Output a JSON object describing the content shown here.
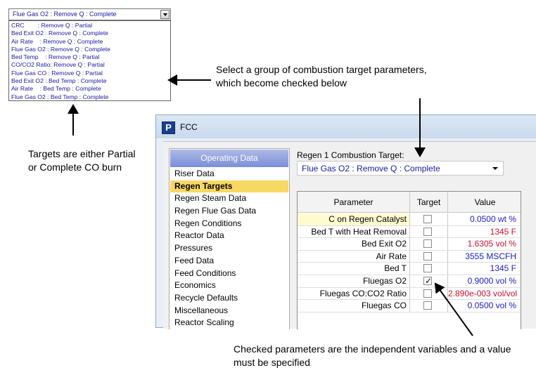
{
  "dropdown": {
    "selected": "Flue Gas O2 : Remove Q : Complete",
    "options": [
      "CRC        : Remove Q : Partial",
      "Bed Exit O2 : Remove Q : Complete",
      "Air Rate    : Remove Q : Complete",
      "Flue Gas O2 : Remove Q : Complete",
      "Bed Temp    : Remove Q : Partial",
      "CO/CO2 Ratio: Remove Q : Partial",
      "Flue Gas CO : Remove Q : Partial",
      "Bed Exit O2 : Bed Temp : Complete",
      "Air Rate    : Bed Temp : Complete",
      "Flue Gas O2 : Bed Temp : Complete"
    ]
  },
  "annotations": {
    "select_group": "Select a group of combustion target parameters, which become checked below",
    "targets_partial": "Targets are either Partial or Complete CO burn",
    "checked_params": "Checked parameters are the independent variables and a value must be specified"
  },
  "window": {
    "title": "FCC",
    "logo": "P"
  },
  "nav": {
    "header": "Operating Data",
    "items": [
      "Riser Data",
      "Regen Targets",
      "Regen Steam Data",
      "Regen Flue Gas Data",
      "Regen Conditions",
      "Reactor Data",
      "Pressures",
      "Feed Data",
      "Feed Conditions",
      "Economics",
      "Recycle Defaults",
      "Miscellaneous",
      "Reactor Scaling"
    ],
    "selected_index": 1
  },
  "combustion_target": {
    "label": "Regen 1 Combustion Target:",
    "value": "Flue Gas O2 : Remove Q : Complete"
  },
  "grid": {
    "headers": [
      "Parameter",
      "Target",
      "Value"
    ],
    "rows": [
      {
        "param": "C on Regen Catalyst",
        "checked": false,
        "value": "0.0500 wt %",
        "value_color": "#1a1acc"
      },
      {
        "param": "Bed T with Heat Removal",
        "checked": false,
        "value": "1345 F",
        "value_color": "#d01030"
      },
      {
        "param": "Bed Exit O2",
        "checked": false,
        "value": "1.6305 vol %",
        "value_color": "#d01030"
      },
      {
        "param": "Air Rate",
        "checked": false,
        "value": "3555 MSCFH",
        "value_color": "#1a1acc"
      },
      {
        "param": "Bed T",
        "checked": false,
        "value": "1345 F",
        "value_color": "#1a1acc"
      },
      {
        "param": "Fluegas O2",
        "checked": true,
        "value": "0.9000 vol %",
        "value_color": "#1a1acc"
      },
      {
        "param": "Fluegas CO:CO2 Ratio",
        "checked": false,
        "value": "2.890e-003 vol/vol",
        "value_color": "#d01030"
      },
      {
        "param": "Fluegas CO",
        "checked": false,
        "value": "0.0500 vol %",
        "value_color": "#1a1acc"
      }
    ]
  }
}
